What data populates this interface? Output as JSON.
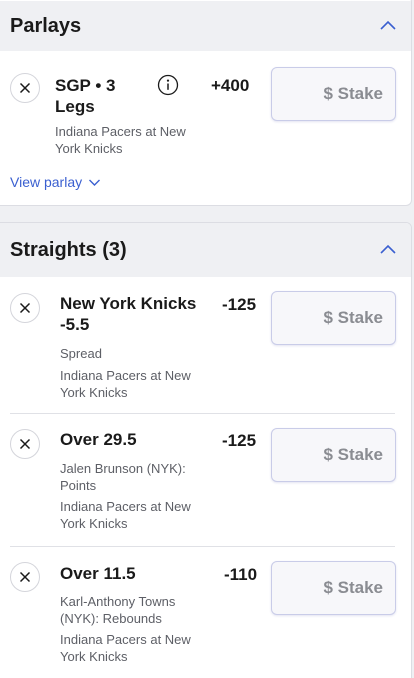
{
  "parlays": {
    "title": "Parlays",
    "bet": {
      "selection": "SGP • 3 Legs",
      "odds": "+400",
      "event": "Indiana Pacers at New York Knicks",
      "stake_placeholder": "$ Stake"
    },
    "view_parlay": "View parlay"
  },
  "straights": {
    "title": "Straights (3)",
    "bets": [
      {
        "selection": "New York Knicks -5.5",
        "odds": "-125",
        "market": "Spread",
        "event": "Indiana Pacers at New York Knicks",
        "stake_placeholder": "$ Stake"
      },
      {
        "selection": "Over 29.5",
        "odds": "-125",
        "market": "Jalen Brunson (NYK): Points",
        "event": "Indiana Pacers at New York Knicks",
        "stake_placeholder": "$ Stake"
      },
      {
        "selection": "Over 11.5",
        "odds": "-110",
        "market": "Karl-Anthony Towns (NYK): Rebounds",
        "event": "Indiana Pacers at New York Knicks",
        "stake_placeholder": "$ Stake"
      }
    ]
  },
  "colors": {
    "accent": "#3a5fd0",
    "header_bg": "#eff0f3",
    "text": "#1a1a1a",
    "muted": "#5d5f66"
  }
}
